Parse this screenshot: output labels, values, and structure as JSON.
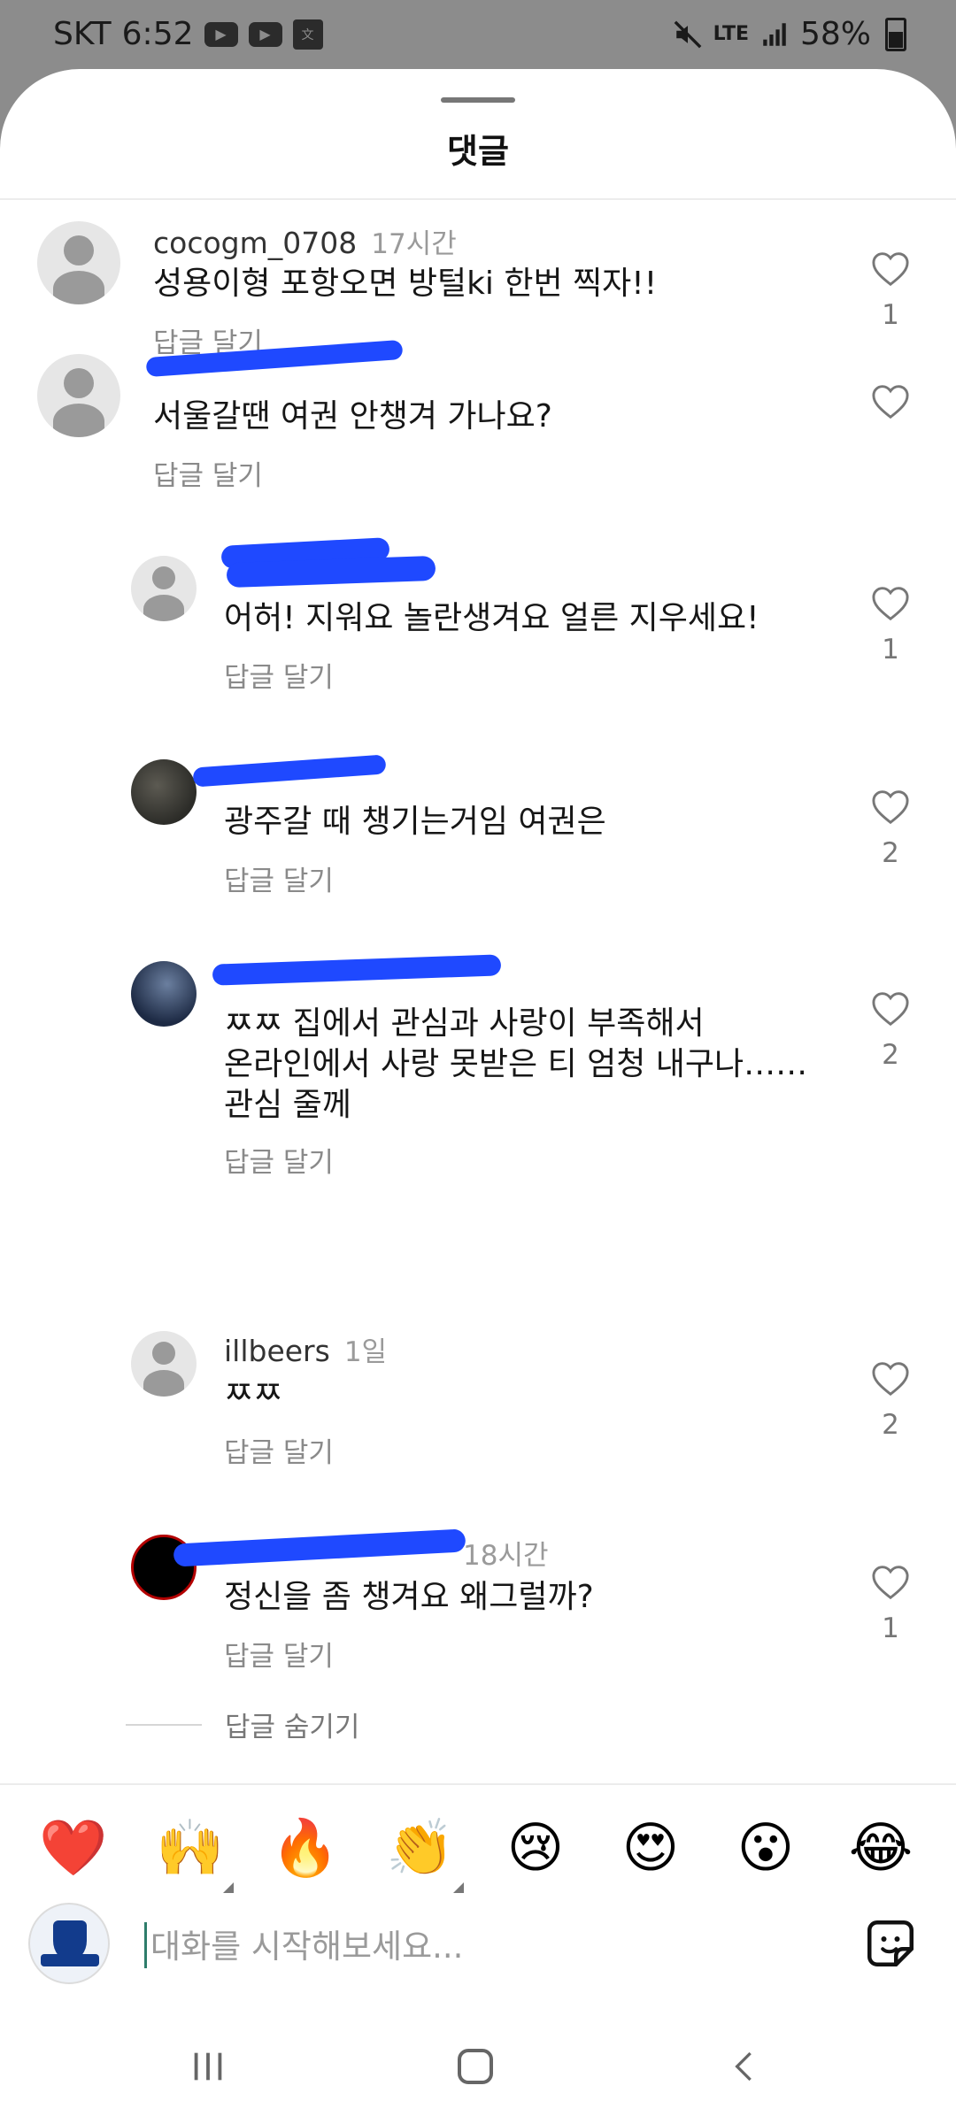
{
  "status_bar": {
    "carrier": "SKT",
    "time": "6:52",
    "lte": "LTE",
    "battery": "58%"
  },
  "sheet": {
    "title": "댓글"
  },
  "comments": [
    {
      "username": "cocogm_0708",
      "time": "17시간",
      "text": "성용이형 포항오면 방털ki 한번 찍자!!",
      "reply": "답글 달기",
      "likes": "1"
    },
    {
      "username": "",
      "time": "",
      "text": "서울갈땐 여권 안챙겨 가나요?",
      "reply": "답글 달기",
      "likes": ""
    },
    {
      "username": "",
      "time": "",
      "text": "어허! 지워요 놀란생겨요 얼른 지우세요!",
      "reply": "답글 달기",
      "likes": "1"
    },
    {
      "username": "",
      "time": "",
      "text": "광주갈 때 챙기는거임 여권은",
      "reply": "답글 달기",
      "likes": "2"
    },
    {
      "username": "",
      "time": "",
      "text_lines": [
        "ㅉㅉ 집에서 관심과 사랑이 부족해서",
        "온라인에서 사랑 못받은 티 엄청 내구나……",
        "관심 줄께"
      ],
      "reply": "답글 달기",
      "likes": "2"
    },
    {
      "username": "illbeers",
      "time": "1일",
      "text": "ㅉㅉ",
      "reply": "답글 달기",
      "likes": "2"
    },
    {
      "username": "",
      "time": "18시간",
      "text": "정신을 좀 챙겨요 왜그럴까?",
      "reply": "답글 달기",
      "likes": "1"
    }
  ],
  "hide_replies": "답글 숨기기",
  "emoji_bar": [
    "❤️",
    "🙌",
    "🔥",
    "👏",
    "😢",
    "😍",
    "😮",
    "😂"
  ],
  "input": {
    "placeholder": "대화를 시작해보세요..."
  },
  "icons": {
    "heart": "heart-outline-icon",
    "sticker": "sticker-icon",
    "nav_recents": "recents-icon",
    "nav_home": "home-icon",
    "nav_back": "back-icon"
  }
}
